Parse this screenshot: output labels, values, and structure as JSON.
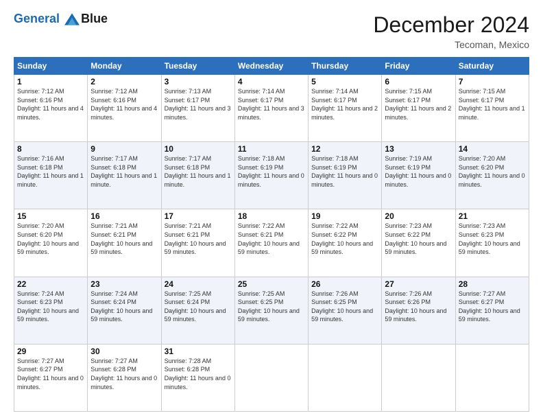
{
  "logo": {
    "line1": "General",
    "line2": "Blue"
  },
  "title": "December 2024",
  "subtitle": "Tecoman, Mexico",
  "days_header": [
    "Sunday",
    "Monday",
    "Tuesday",
    "Wednesday",
    "Thursday",
    "Friday",
    "Saturday"
  ],
  "weeks": [
    [
      {
        "day": "1",
        "sunrise": "7:12 AM",
        "sunset": "6:16 PM",
        "daylight": "11 hours and 4 minutes."
      },
      {
        "day": "2",
        "sunrise": "7:12 AM",
        "sunset": "6:16 PM",
        "daylight": "11 hours and 4 minutes."
      },
      {
        "day": "3",
        "sunrise": "7:13 AM",
        "sunset": "6:17 PM",
        "daylight": "11 hours and 3 minutes."
      },
      {
        "day": "4",
        "sunrise": "7:14 AM",
        "sunset": "6:17 PM",
        "daylight": "11 hours and 3 minutes."
      },
      {
        "day": "5",
        "sunrise": "7:14 AM",
        "sunset": "6:17 PM",
        "daylight": "11 hours and 2 minutes."
      },
      {
        "day": "6",
        "sunrise": "7:15 AM",
        "sunset": "6:17 PM",
        "daylight": "11 hours and 2 minutes."
      },
      {
        "day": "7",
        "sunrise": "7:15 AM",
        "sunset": "6:17 PM",
        "daylight": "11 hours and 1 minute."
      }
    ],
    [
      {
        "day": "8",
        "sunrise": "7:16 AM",
        "sunset": "6:18 PM",
        "daylight": "11 hours and 1 minute."
      },
      {
        "day": "9",
        "sunrise": "7:17 AM",
        "sunset": "6:18 PM",
        "daylight": "11 hours and 1 minute."
      },
      {
        "day": "10",
        "sunrise": "7:17 AM",
        "sunset": "6:18 PM",
        "daylight": "11 hours and 1 minute."
      },
      {
        "day": "11",
        "sunrise": "7:18 AM",
        "sunset": "6:19 PM",
        "daylight": "11 hours and 0 minutes."
      },
      {
        "day": "12",
        "sunrise": "7:18 AM",
        "sunset": "6:19 PM",
        "daylight": "11 hours and 0 minutes."
      },
      {
        "day": "13",
        "sunrise": "7:19 AM",
        "sunset": "6:19 PM",
        "daylight": "11 hours and 0 minutes."
      },
      {
        "day": "14",
        "sunrise": "7:20 AM",
        "sunset": "6:20 PM",
        "daylight": "11 hours and 0 minutes."
      }
    ],
    [
      {
        "day": "15",
        "sunrise": "7:20 AM",
        "sunset": "6:20 PM",
        "daylight": "10 hours and 59 minutes."
      },
      {
        "day": "16",
        "sunrise": "7:21 AM",
        "sunset": "6:21 PM",
        "daylight": "10 hours and 59 minutes."
      },
      {
        "day": "17",
        "sunrise": "7:21 AM",
        "sunset": "6:21 PM",
        "daylight": "10 hours and 59 minutes."
      },
      {
        "day": "18",
        "sunrise": "7:22 AM",
        "sunset": "6:21 PM",
        "daylight": "10 hours and 59 minutes."
      },
      {
        "day": "19",
        "sunrise": "7:22 AM",
        "sunset": "6:22 PM",
        "daylight": "10 hours and 59 minutes."
      },
      {
        "day": "20",
        "sunrise": "7:23 AM",
        "sunset": "6:22 PM",
        "daylight": "10 hours and 59 minutes."
      },
      {
        "day": "21",
        "sunrise": "7:23 AM",
        "sunset": "6:23 PM",
        "daylight": "10 hours and 59 minutes."
      }
    ],
    [
      {
        "day": "22",
        "sunrise": "7:24 AM",
        "sunset": "6:23 PM",
        "daylight": "10 hours and 59 minutes."
      },
      {
        "day": "23",
        "sunrise": "7:24 AM",
        "sunset": "6:24 PM",
        "daylight": "10 hours and 59 minutes."
      },
      {
        "day": "24",
        "sunrise": "7:25 AM",
        "sunset": "6:24 PM",
        "daylight": "10 hours and 59 minutes."
      },
      {
        "day": "25",
        "sunrise": "7:25 AM",
        "sunset": "6:25 PM",
        "daylight": "10 hours and 59 minutes."
      },
      {
        "day": "26",
        "sunrise": "7:26 AM",
        "sunset": "6:25 PM",
        "daylight": "10 hours and 59 minutes."
      },
      {
        "day": "27",
        "sunrise": "7:26 AM",
        "sunset": "6:26 PM",
        "daylight": "10 hours and 59 minutes."
      },
      {
        "day": "28",
        "sunrise": "7:27 AM",
        "sunset": "6:27 PM",
        "daylight": "10 hours and 59 minutes."
      }
    ],
    [
      {
        "day": "29",
        "sunrise": "7:27 AM",
        "sunset": "6:27 PM",
        "daylight": "11 hours and 0 minutes."
      },
      {
        "day": "30",
        "sunrise": "7:27 AM",
        "sunset": "6:28 PM",
        "daylight": "11 hours and 0 minutes."
      },
      {
        "day": "31",
        "sunrise": "7:28 AM",
        "sunset": "6:28 PM",
        "daylight": "11 hours and 0 minutes."
      },
      null,
      null,
      null,
      null
    ]
  ]
}
